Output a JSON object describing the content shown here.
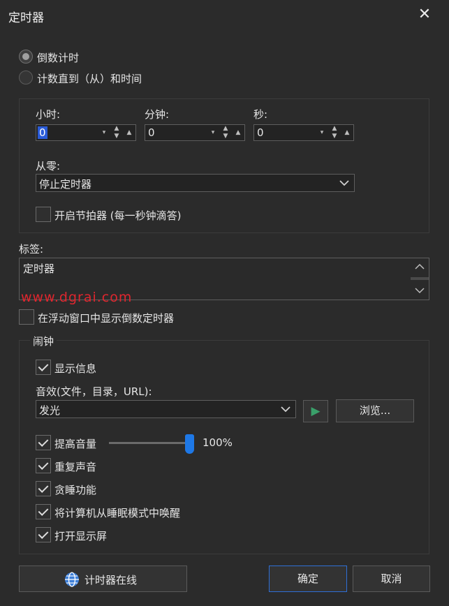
{
  "window": {
    "title": "定时器",
    "close_label": "✕"
  },
  "mode": {
    "option_countdown": "倒数计时",
    "option_countup": "计数直到（从）和时间"
  },
  "time": {
    "hours_label": "小时:",
    "minutes_label": "分钟:",
    "seconds_label": "秒:",
    "hours_value": "0",
    "minutes_value": "0",
    "seconds_value": "0"
  },
  "from_zero": {
    "label": "从零:",
    "selected": "停止定时器"
  },
  "metronome_label": "开启节拍器 (每一秒钟滴答)",
  "tag": {
    "label": "标签:",
    "value": "定时器"
  },
  "watermark": "www.dgrai.com",
  "floating_window_label": "在浮动窗口中显示倒数定时器",
  "alarm": {
    "group_label": "闹钟",
    "show_message_label": "显示信息",
    "sound_label": "音效(文件，目录，URL):",
    "sound_selected": "发光",
    "play_icon": "▶",
    "browse_label": "浏览...",
    "volume_label": "提高音量",
    "volume_value": "100%",
    "volume_level": 1.0,
    "repeat_label": "重复声音",
    "snooze_label": "贪睡功能",
    "wake_label": "将计算机从睡眠模式中唤醒",
    "display_on_label": "打开显示屏"
  },
  "footer": {
    "online_label": "计时器在线",
    "ok_label": "确定",
    "cancel_label": "取消"
  },
  "colors": {
    "accent": "#2f6fd6",
    "play": "#3aa06a",
    "watermark": "#e0262e"
  }
}
